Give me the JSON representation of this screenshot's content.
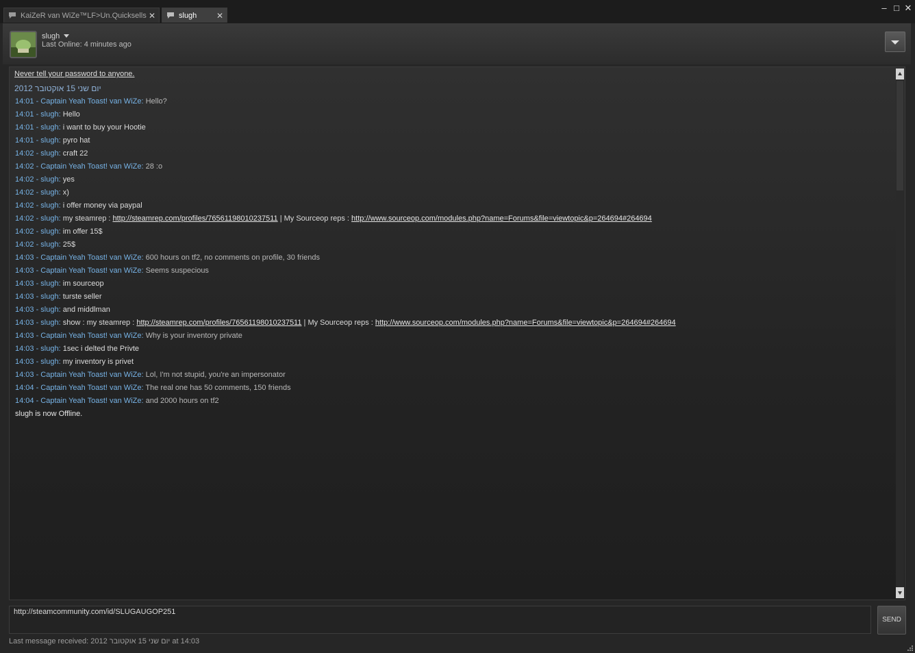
{
  "tabs": [
    {
      "label": "KaiZeR van WiZe™LF>Un.Quicksells",
      "icon": "chat-bubble-icon",
      "active": false
    },
    {
      "label": "slugh",
      "icon": "chat-bubble-icon",
      "active": true
    }
  ],
  "window": {
    "minimize": "–",
    "maximize": "□",
    "close": "✕"
  },
  "header": {
    "name": "slugh",
    "status": "Last Online: 4 minutes ago"
  },
  "chat": {
    "warning": "Never tell your password to anyone.",
    "date_header": "יום שני 15 אוקטובר 2012",
    "messages": [
      {
        "meta": "14:01 - Captain Yeah Toast! van WiZe",
        "text": "Hello?",
        "self": true
      },
      {
        "meta": "14:01 - slugh",
        "text": "Hello"
      },
      {
        "meta": "14:01 - slugh",
        "text": "i want to buy your Hootie"
      },
      {
        "meta": "14:01 - slugh",
        "text": "pyro hat"
      },
      {
        "meta": "14:02 - slugh",
        "text": "craft 22"
      },
      {
        "meta": "14:02 - Captain Yeah Toast! van WiZe",
        "text": "28 :o",
        "self": true
      },
      {
        "meta": "14:02 - slugh",
        "text": "yes"
      },
      {
        "meta": "14:02 - slugh",
        "text": "x)"
      },
      {
        "meta": "14:02 - slugh",
        "text": "i offer money via paypal"
      },
      {
        "meta": "14:02 - slugh",
        "parts": [
          {
            "t": "my steamrep : "
          },
          {
            "link": "http://steamrep.com/profiles/76561198010237511"
          },
          {
            "t": " | My Sourceop reps : "
          },
          {
            "link": "http://www.sourceop.com/modules.php?name=Forums&file=viewtopic&p=264694#264694"
          }
        ]
      },
      {
        "meta": "14:02 - slugh",
        "text": "im offer 15$"
      },
      {
        "meta": "14:02 - slugh",
        "text": "25$"
      },
      {
        "meta": "14:03 - Captain Yeah Toast! van WiZe",
        "text": "600 hours on tf2, no comments on profile, 30 friends",
        "self": true
      },
      {
        "meta": "14:03 - Captain Yeah Toast! van WiZe",
        "text": "Seems suspecious",
        "self": true
      },
      {
        "meta": "14:03 - slugh",
        "text": "im sourceop"
      },
      {
        "meta": "14:03 - slugh",
        "text": "turste seller"
      },
      {
        "meta": "14:03 - slugh",
        "text": "and middlman"
      },
      {
        "meta": "14:03 - slugh",
        "parts": [
          {
            "t": "show : my steamrep : "
          },
          {
            "link": "http://steamrep.com/profiles/76561198010237511"
          },
          {
            "t": " | My Sourceop reps : "
          },
          {
            "link": "http://www.sourceop.com/modules.php?name=Forums&file=viewtopic&p=264694#264694"
          }
        ]
      },
      {
        "meta": "14:03 - Captain Yeah Toast! van WiZe",
        "text": "Why is your inventory private",
        "self": true
      },
      {
        "meta": "14:03 - slugh",
        "text": "1sec i delted the Privte"
      },
      {
        "meta": "14:03 - slugh",
        "text": "my inventory is privet"
      },
      {
        "meta": "14:03 - Captain Yeah Toast! van WiZe",
        "text": "Lol, I'm not stupid, you're an impersonator",
        "self": true
      },
      {
        "meta": "14:04 - Captain Yeah Toast! van WiZe",
        "text": "The real one has 50 comments, 150 friends",
        "self": true
      },
      {
        "meta": "14:04 - Captain Yeah Toast! van WiZe",
        "text": "and 2000 hours on tf2",
        "self": true
      }
    ],
    "system": "slugh is now Offline."
  },
  "input": {
    "value": "http://steamcommunity.com/id/SLUGAUGOP251"
  },
  "send_label": "SEND",
  "footer": "Last message received: יום שני 15 אוקטובר 2012 at 14:03",
  "colors": {
    "timestamp": "#77b3e6",
    "background": "#262626"
  }
}
